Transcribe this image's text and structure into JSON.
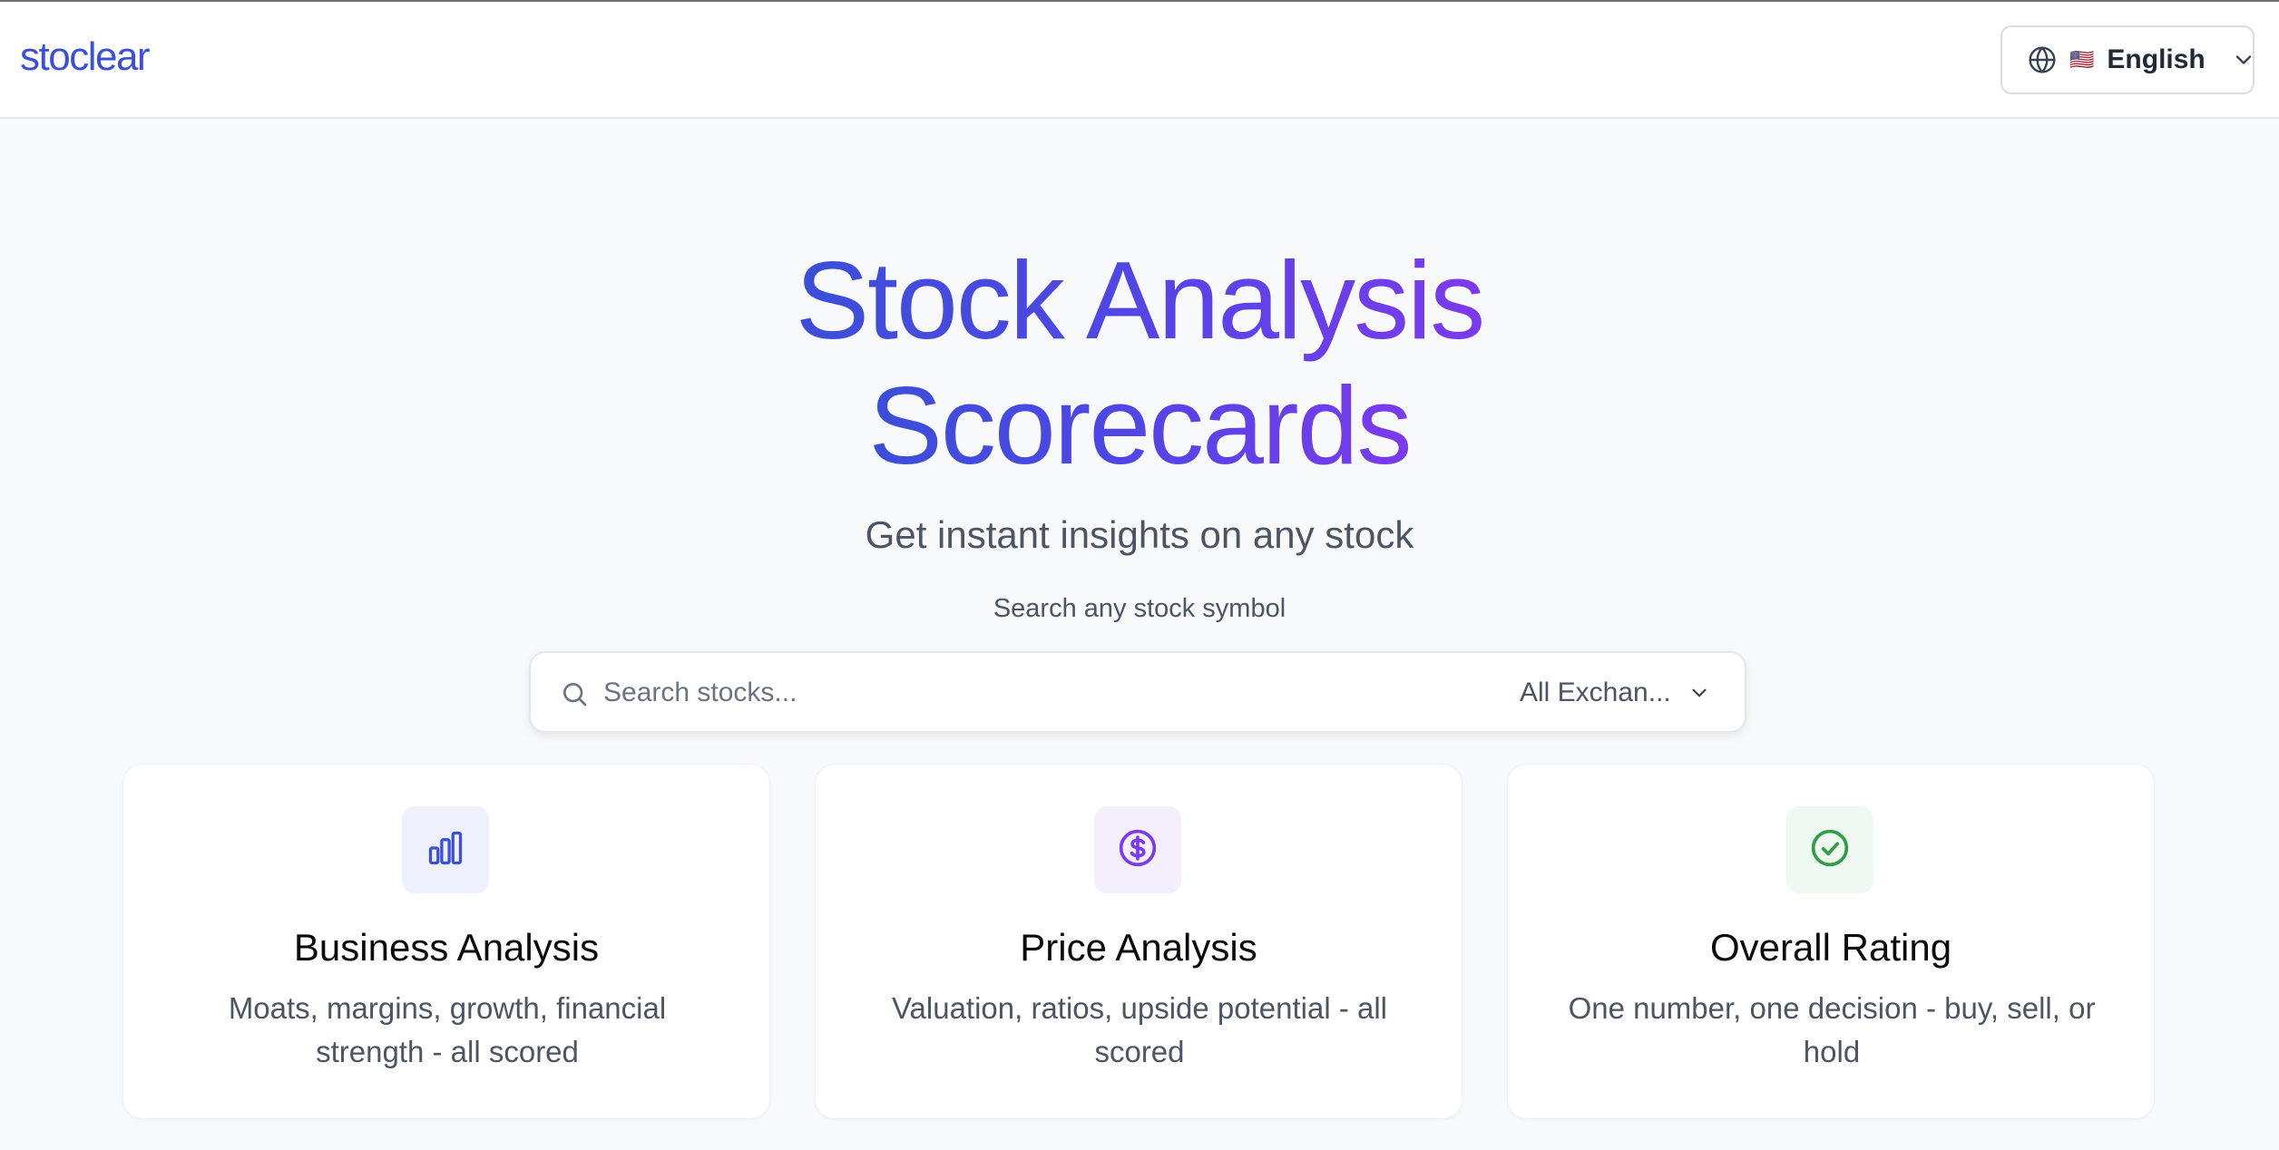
{
  "header": {
    "logo": "stoclear",
    "language": {
      "flag": "🇺🇸",
      "label": "English"
    }
  },
  "hero": {
    "title_line1": "Stock Analysis",
    "title_line2": "Scorecards",
    "subtitle": "Get instant insights on any stock"
  },
  "search": {
    "label": "Search any stock symbol",
    "placeholder": "Search stocks...",
    "exchange_selected": "All Exchan..."
  },
  "features": [
    {
      "title": "Business Analysis",
      "description": "Moats, margins, growth, financial strength - all scored",
      "icon": "bar-chart-icon",
      "accent": "#3b4fd8",
      "bg": "#eef1fd"
    },
    {
      "title": "Price Analysis",
      "description": "Valuation, ratios, upside potential - all scored",
      "icon": "dollar-circle-icon",
      "accent": "#7c3aed",
      "bg": "#f4effd"
    },
    {
      "title": "Overall Rating",
      "description": "One number, one decision - buy, sell, or hold",
      "icon": "check-circle-icon",
      "accent": "#2f9e44",
      "bg": "#eefaf1"
    }
  ],
  "colors": {
    "brand": "#3b4fd8",
    "gradient_end": "#7c3aed",
    "background": "#f8f9fb"
  }
}
